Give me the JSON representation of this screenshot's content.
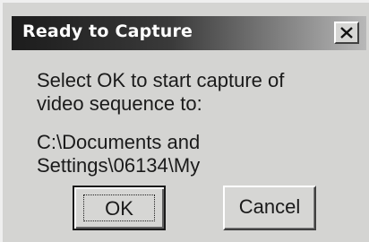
{
  "window": {
    "title": "Ready to Capture",
    "close_icon": "close-icon"
  },
  "message": {
    "line1": "Select OK to start capture of",
    "line2": "video sequence to:",
    "path_line1": "C:\\Documents and",
    "path_line2": "Settings\\06134\\My"
  },
  "buttons": {
    "ok_label": "OK",
    "cancel_label": "Cancel"
  }
}
